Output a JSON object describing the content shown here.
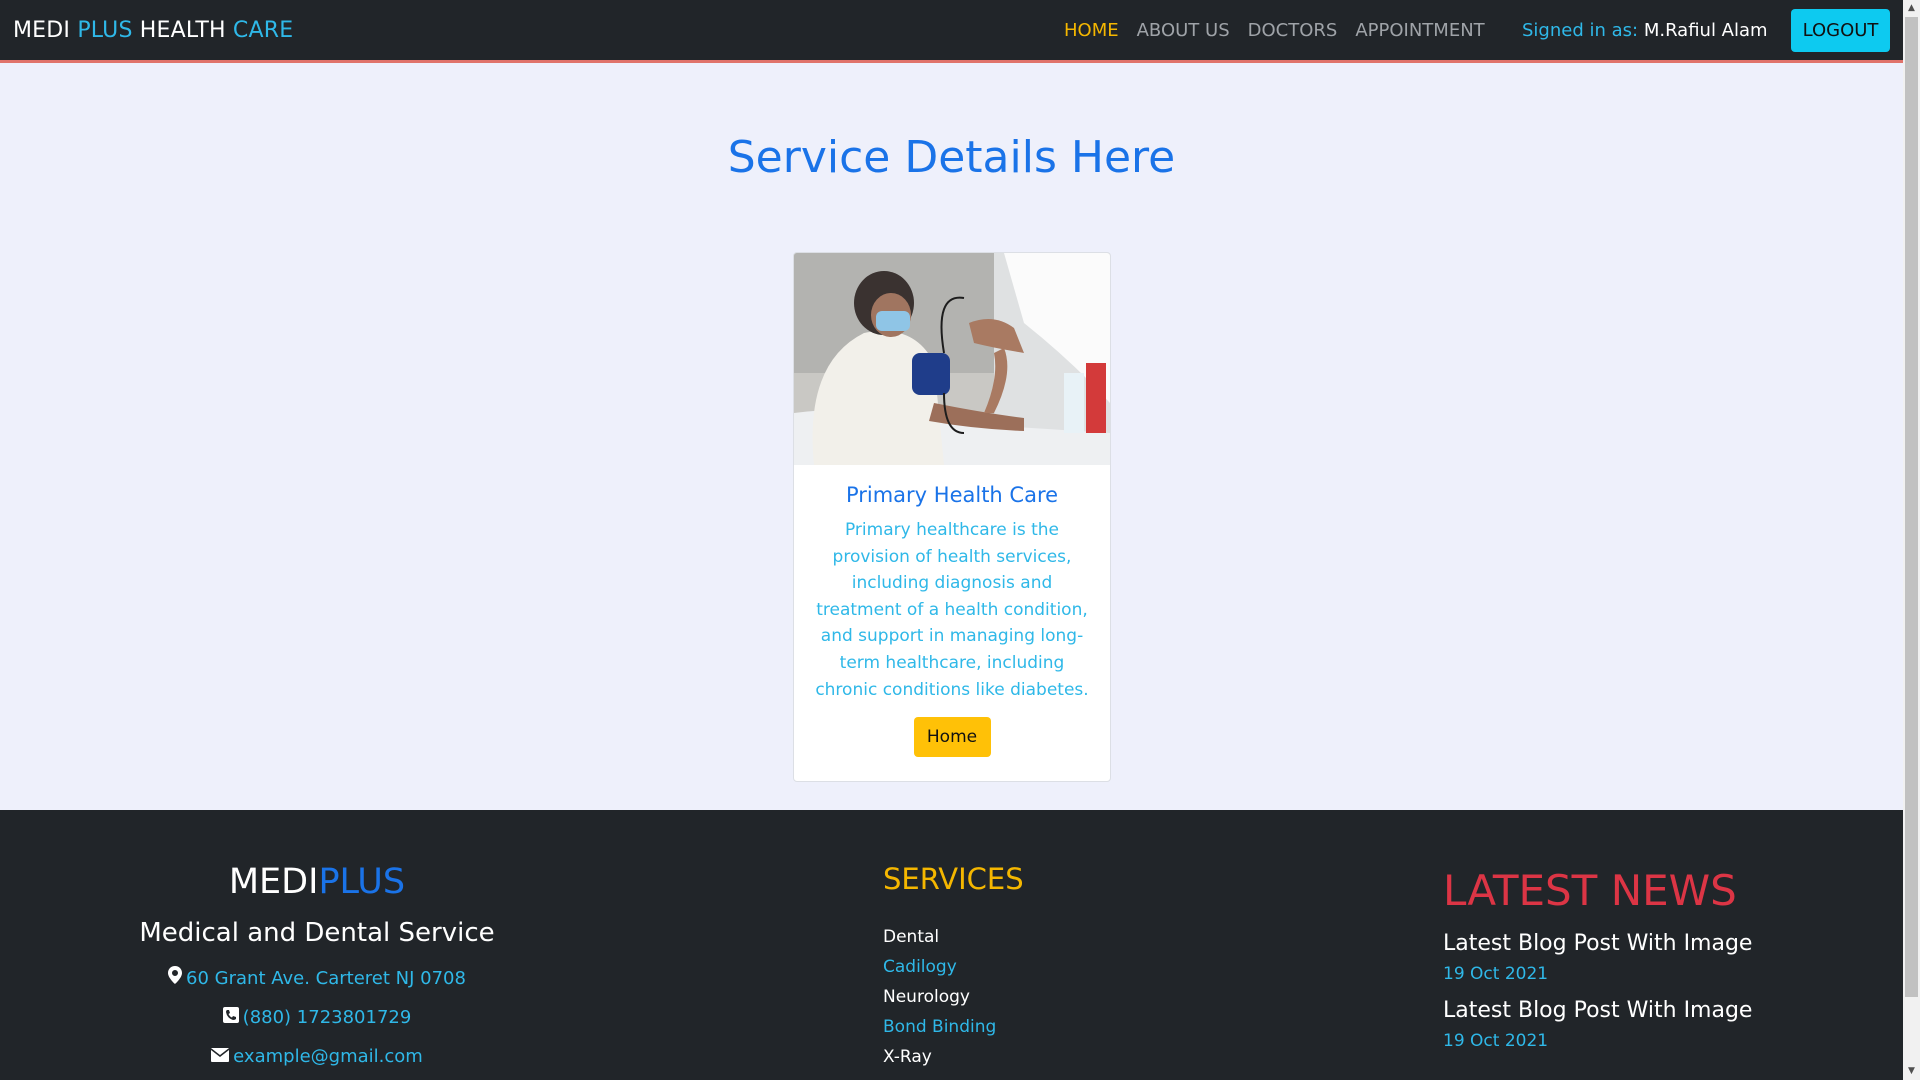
{
  "navbar": {
    "brand": {
      "part1": "MEDI ",
      "part2": "PLUS",
      "part3": " HEALTH ",
      "part4": "CARE"
    },
    "links": [
      {
        "label": "HOME",
        "active": true
      },
      {
        "label": "ABOUT US",
        "active": false
      },
      {
        "label": "DOCTORS",
        "active": false
      },
      {
        "label": "APPOINTMENT",
        "active": false
      }
    ],
    "signed_in_label": "Signed in as: ",
    "user_name": "M.Rafiul Alam",
    "logout_label": "LOGOUT"
  },
  "main": {
    "title": "Service Details Here",
    "service": {
      "name": "Primary Health Care",
      "description": "Primary healthcare is the provision of health services, including diagnosis and treatment of a health condition, and support in managing long-term healthcare, including chronic conditions like diabetes.",
      "button_label": "Home"
    }
  },
  "footer": {
    "brand": {
      "part1": "MEDI",
      "part2": "PLUS"
    },
    "subtitle": "Medical and Dental Service",
    "address": "60 Grant Ave. Carteret NJ 0708",
    "phone": "(880) 1723801729",
    "email": "example@gmail.com",
    "services_title": "SERVICES",
    "services": [
      {
        "label": "Dental",
        "color": "white"
      },
      {
        "label": "Cadilogy",
        "color": "blue"
      },
      {
        "label": "Neurology",
        "color": "white"
      },
      {
        "label": "Bond Binding",
        "color": "blue"
      },
      {
        "label": "X-Ray",
        "color": "white"
      }
    ],
    "news_title": "LATEST NEWS",
    "news": [
      {
        "title": "Latest Blog Post With Image",
        "date": "19 Oct 2021"
      },
      {
        "title": "Latest Blog Post With Image",
        "date": "19 Oct 2021"
      }
    ]
  },
  "colors": {
    "navbar_bg": "#212529",
    "accent_blue": "#1a73e8",
    "accent_cyan": "#2fb8e8",
    "accent_yellow": "#ffc107",
    "accent_red": "#dc3545",
    "page_bg": "#eef0fb"
  },
  "icons": [
    "map-marker-icon",
    "phone-icon",
    "envelope-icon"
  ]
}
